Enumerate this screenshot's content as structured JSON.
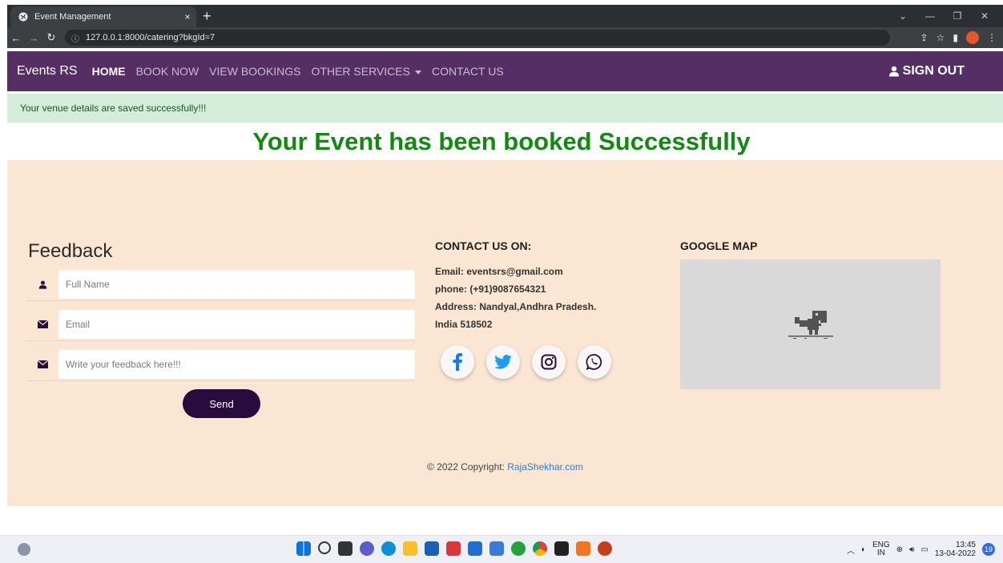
{
  "browser": {
    "tab_title": "Event Management",
    "tab_close": "×",
    "new_tab": "+",
    "url_info": "ⓘ",
    "url": "127.0.0.1:8000/catering?bkgId=7"
  },
  "navbar": {
    "brand": "Events RS",
    "links": [
      {
        "label": "HOME",
        "active": true
      },
      {
        "label": "BOOK NOW"
      },
      {
        "label": "VIEW BOOKINGS"
      },
      {
        "label": "OTHER SERVICES"
      },
      {
        "label": "CONTACT US"
      }
    ],
    "signout": "SIGN OUT",
    "signout_icon": "user-icon"
  },
  "alert": {
    "text": "Your venue details are saved successfully!!!"
  },
  "headline": "Your Event has been booked Successfully",
  "feedback": {
    "title": "Feedback",
    "name_placeholder": "Full Name",
    "email_placeholder": "Email",
    "message_placeholder": "Write your feedback here!!!",
    "send_label": "Send"
  },
  "contact": {
    "title": "CONTACT US ON:",
    "email": "Email: eventsrs@gmail.com",
    "phone": "phone: (+91)9087654321",
    "address": "Address: Nandyal,Andhra Pradesh.",
    "address2": "India 518502",
    "social": [
      "facebook-icon",
      "twitter-icon",
      "instagram-icon",
      "whatsapp-icon"
    ]
  },
  "map": {
    "title": "GOOGLE MAP"
  },
  "footer": {
    "copyright": "© 2022 Copyright: ",
    "link": "RajaShekhar.com"
  },
  "taskbar": {
    "lang": "ENG",
    "region": "IN",
    "time": "13:45",
    "date": "13-04-2022",
    "notifications": "19"
  },
  "colors": {
    "navbar": "#552f63",
    "footer_bg": "#fae6d2",
    "headline": "#128a12",
    "alert_bg": "#d4edda",
    "button": "#2a0b3e",
    "social_blue": "#1877f2",
    "twitter_blue": "#1d9bf0"
  }
}
